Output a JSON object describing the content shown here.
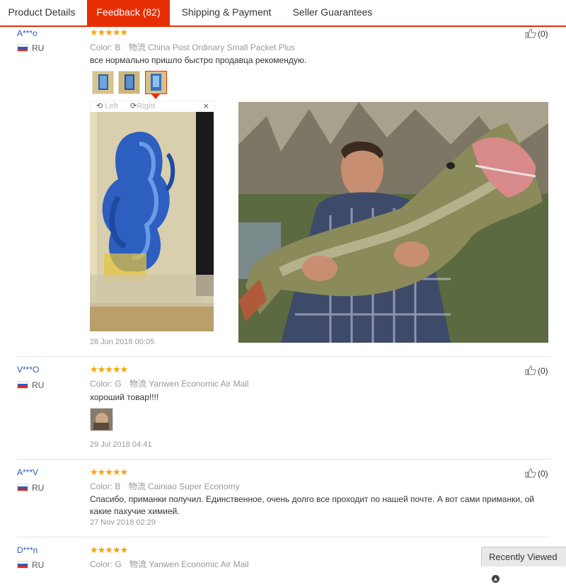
{
  "tabs": [
    {
      "label": "Product Details"
    },
    {
      "label": "Feedback (82)"
    },
    {
      "label": "Shipping & Payment"
    },
    {
      "label": "Seller Guarantees"
    }
  ],
  "rating_stars": "★★★★★",
  "labels": {
    "color": "Color:",
    "shipping": "物流",
    "rotate_left": "Left",
    "rotate_right": "Right",
    "close": "×"
  },
  "reviews": [
    {
      "user": "A***o",
      "country": "RU",
      "color": "B",
      "shipping": "China Post Ordinary Small Packet Plus",
      "text": "все нормально пришло быстро продавца рекомендую.",
      "date": "28 Jun 2018 00:05",
      "helpful": "(0)"
    },
    {
      "user": "V***O",
      "country": "RU",
      "color": "G",
      "shipping": "Yanwen Economic Air Mail",
      "text": "хороший товар!!!!",
      "date": "29 Jul 2018 04:41",
      "helpful": "(0)"
    },
    {
      "user": "A***V",
      "country": "RU",
      "color": "B",
      "shipping": "Cainiao Super Economy",
      "text": "Спасибо, приманки получил. Единственное, очень долго все проходит по нашей почте. А вот сами приманки, ой какие пахучие химией.",
      "date": "27 Nov 2018 02:29",
      "helpful": "(0)"
    },
    {
      "user": "D***n",
      "country": "RU",
      "color": "G",
      "shipping": "Yanwen Economic Air Mail",
      "text": "",
      "date": "",
      "helpful": ""
    }
  ],
  "recently_viewed": "Recently Viewed",
  "colors": {
    "accent": "#e62e04",
    "star": "#f7a400",
    "link": "#2b5ab8"
  }
}
